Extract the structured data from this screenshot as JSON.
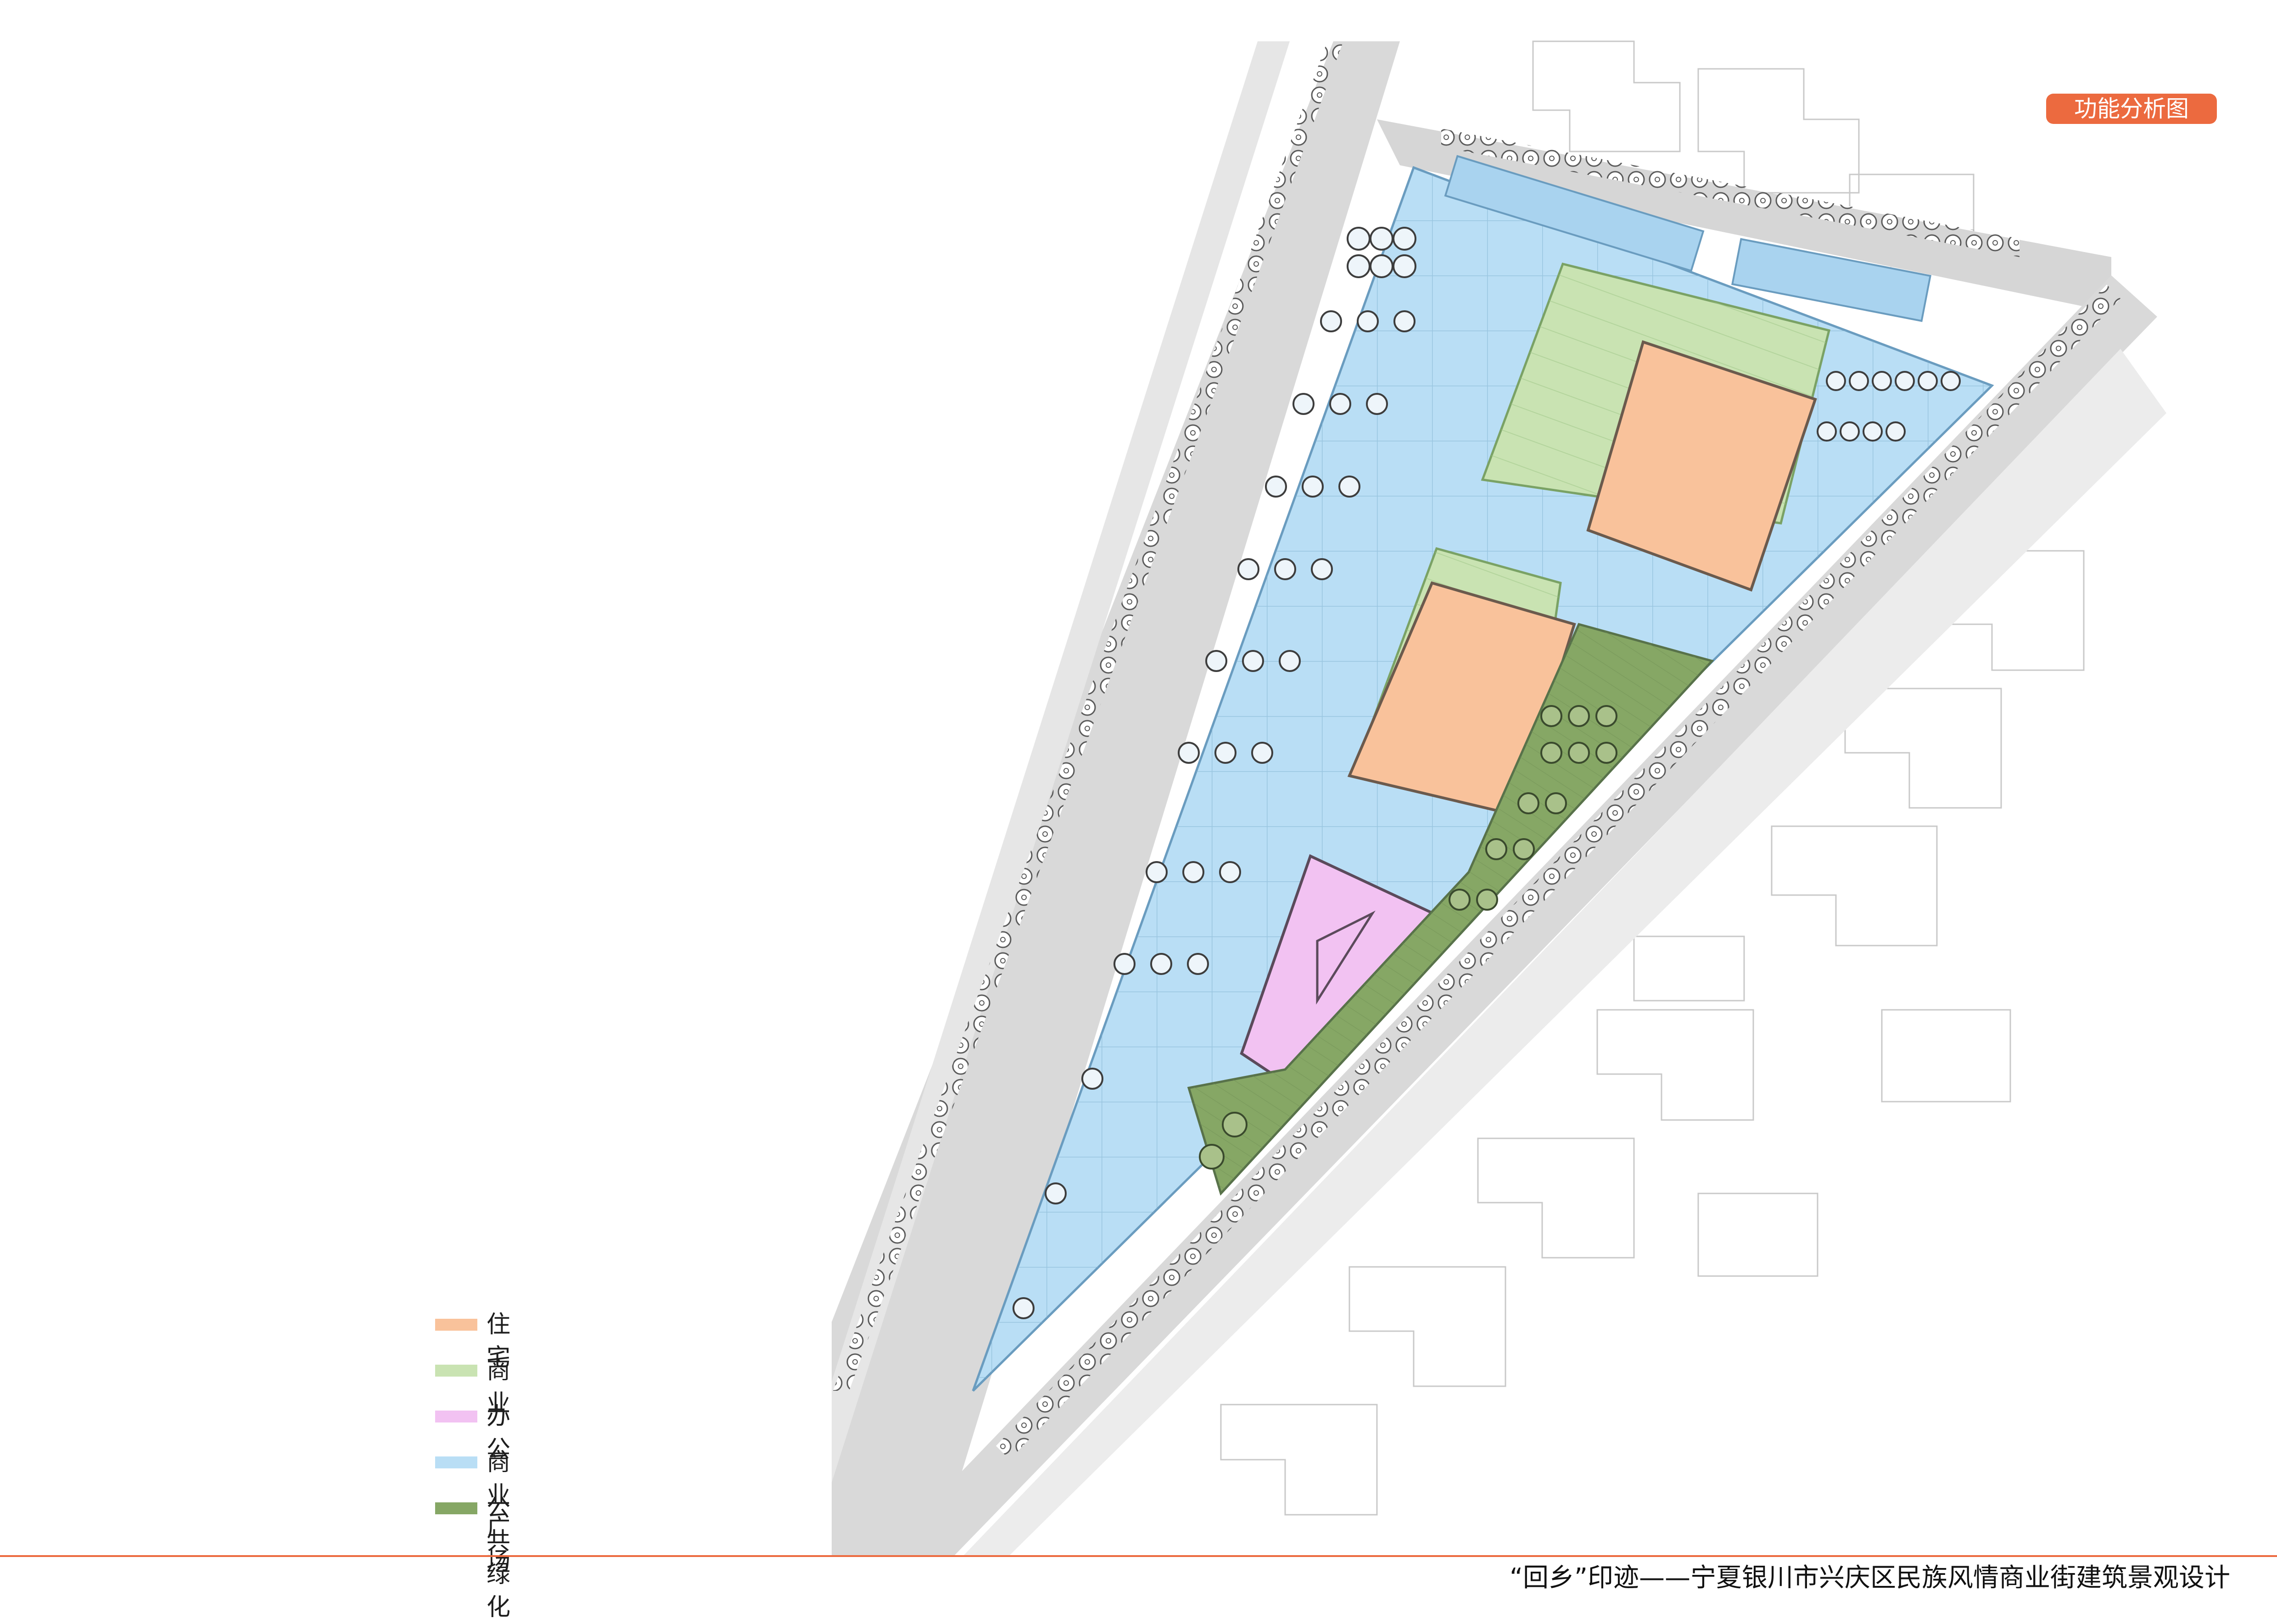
{
  "header": {
    "badge_label": "功能分析图",
    "badge_color": "#ec6a3f"
  },
  "legend": {
    "items": [
      {
        "label": "住宅",
        "color": "#f9c29b"
      },
      {
        "label": "商业",
        "color": "#c9e3b2"
      },
      {
        "label": "办公",
        "color": "#f2c2f2"
      },
      {
        "label": "商业广场",
        "color": "#b9def5"
      },
      {
        "label": "公共绿化",
        "color": "#86a765"
      }
    ]
  },
  "footer": {
    "title": "“回乡”印迹——宁夏银川市兴庆区民族风情商业街建筑景观设计"
  },
  "map_features": {
    "roads": [
      "west-road",
      "north-road",
      "southeast-road"
    ],
    "zones": [
      "residential-block-north",
      "residential-block-south",
      "commercial-strip-north",
      "commercial-strip-south",
      "office-building",
      "commercial-plaza",
      "public-green-belt"
    ],
    "icons": [
      "tree-icon",
      "parking-icon"
    ]
  }
}
